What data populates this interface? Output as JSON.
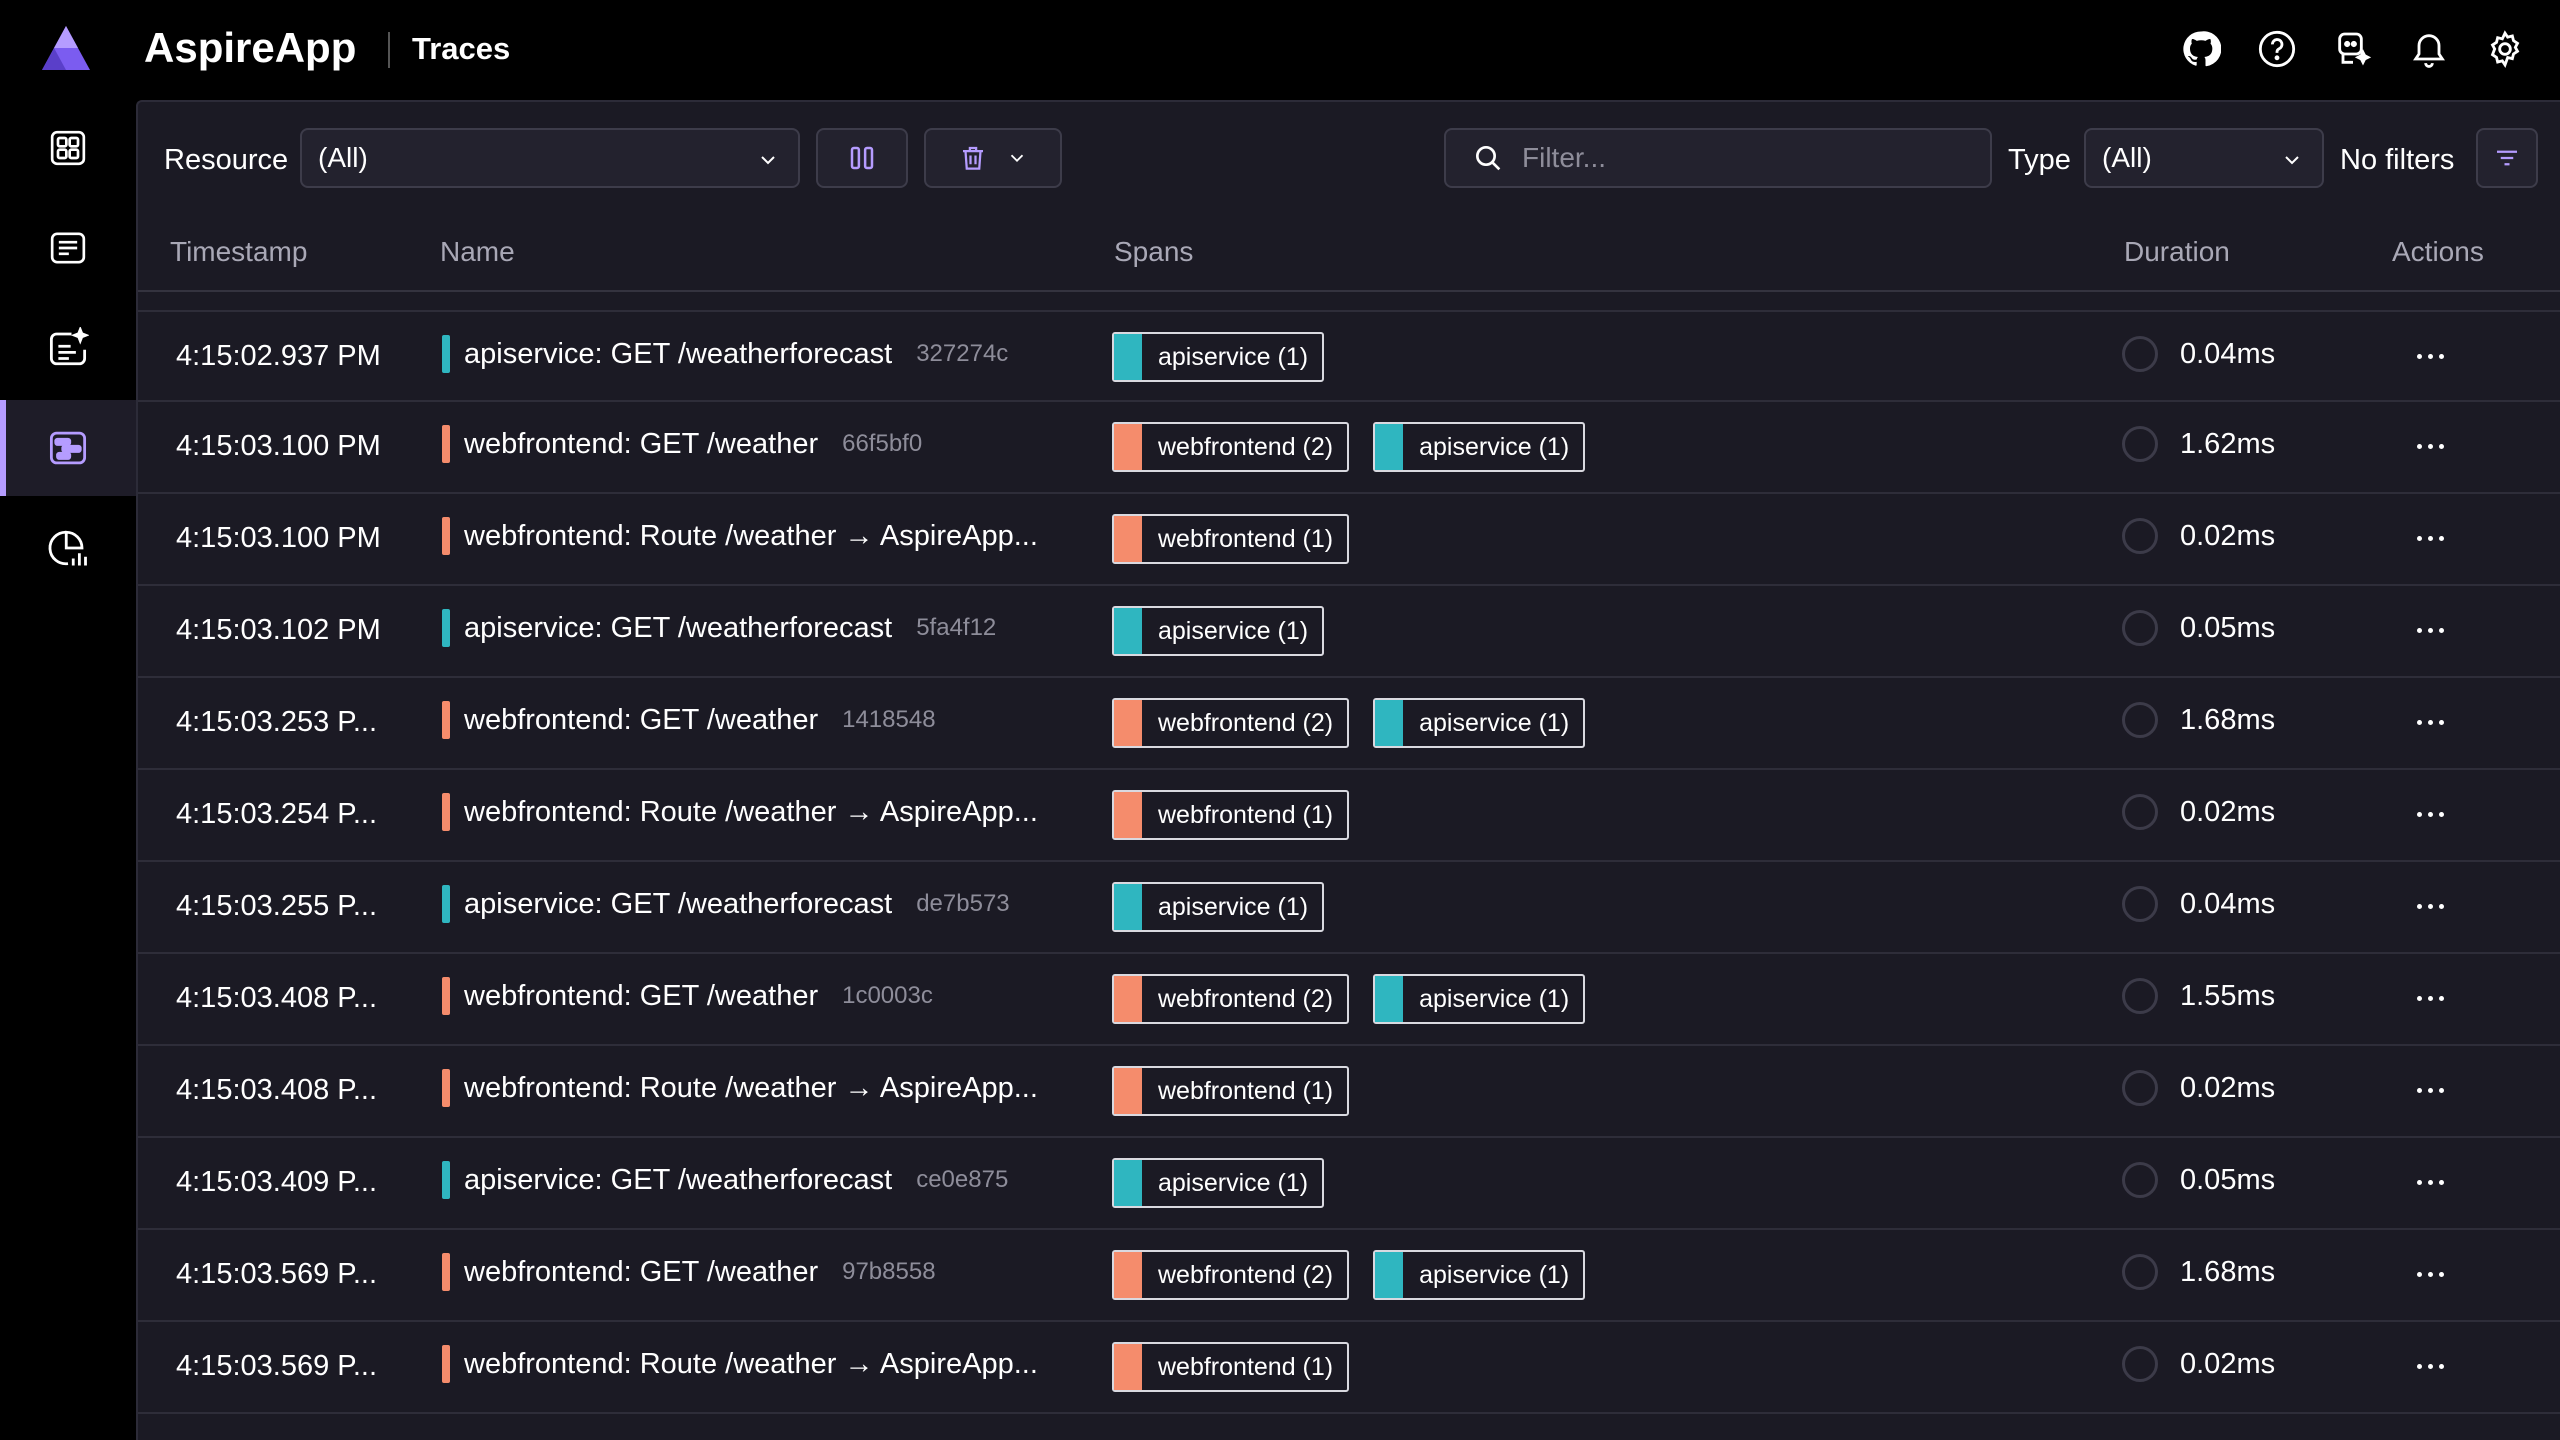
{
  "app": {
    "name": "AspireApp",
    "page": "Traces"
  },
  "colors": {
    "accent": "#b59cff",
    "webfrontend": "#f58c6c",
    "apiservice": "#2fb6c0"
  },
  "top_icons": [
    "github-icon",
    "help-icon",
    "copilot-icon",
    "notifications-icon",
    "settings-icon"
  ],
  "nav": [
    "resources-icon",
    "console-logs-icon",
    "structured-logs-icon",
    "traces-icon",
    "metrics-icon"
  ],
  "toolbar": {
    "resource_label": "Resource",
    "resource_value": "(All)",
    "filter_placeholder": "Filter...",
    "type_label": "Type",
    "type_value": "(All)",
    "no_filters": "No filters"
  },
  "columns": [
    "Timestamp",
    "Name",
    "Spans",
    "Duration",
    "Actions"
  ],
  "rows": [
    {
      "ts": "4:15:02.937 PM",
      "res": "apiservice",
      "name": "apiservice: GET /weatherforecast",
      "id": "327274c",
      "spans": [
        {
          "res": "apiservice",
          "label": "apiservice (1)"
        }
      ],
      "dur": "0.04ms"
    },
    {
      "ts": "4:15:03.100 PM",
      "res": "webfrontend",
      "name": "webfrontend: GET /weather",
      "id": "66f5bf0",
      "spans": [
        {
          "res": "webfrontend",
          "label": "webfrontend (2)"
        },
        {
          "res": "apiservice",
          "label": "apiservice (1)"
        }
      ],
      "dur": "1.62ms"
    },
    {
      "ts": "4:15:03.100 PM",
      "res": "webfrontend",
      "name": "webfrontend: Route /weather → AspireApp...",
      "id": "",
      "spans": [
        {
          "res": "webfrontend",
          "label": "webfrontend (1)"
        }
      ],
      "dur": "0.02ms"
    },
    {
      "ts": "4:15:03.102 PM",
      "res": "apiservice",
      "name": "apiservice: GET /weatherforecast",
      "id": "5fa4f12",
      "spans": [
        {
          "res": "apiservice",
          "label": "apiservice (1)"
        }
      ],
      "dur": "0.05ms"
    },
    {
      "ts": "4:15:03.253 P...",
      "res": "webfrontend",
      "name": "webfrontend: GET /weather",
      "id": "1418548",
      "spans": [
        {
          "res": "webfrontend",
          "label": "webfrontend (2)"
        },
        {
          "res": "apiservice",
          "label": "apiservice (1)"
        }
      ],
      "dur": "1.68ms"
    },
    {
      "ts": "4:15:03.254 P...",
      "res": "webfrontend",
      "name": "webfrontend: Route /weather → AspireApp...",
      "id": "",
      "spans": [
        {
          "res": "webfrontend",
          "label": "webfrontend (1)"
        }
      ],
      "dur": "0.02ms"
    },
    {
      "ts": "4:15:03.255 P...",
      "res": "apiservice",
      "name": "apiservice: GET /weatherforecast",
      "id": "de7b573",
      "spans": [
        {
          "res": "apiservice",
          "label": "apiservice (1)"
        }
      ],
      "dur": "0.04ms"
    },
    {
      "ts": "4:15:03.408 P...",
      "res": "webfrontend",
      "name": "webfrontend: GET /weather",
      "id": "1c0003c",
      "spans": [
        {
          "res": "webfrontend",
          "label": "webfrontend (2)"
        },
        {
          "res": "apiservice",
          "label": "apiservice (1)"
        }
      ],
      "dur": "1.55ms"
    },
    {
      "ts": "4:15:03.408 P...",
      "res": "webfrontend",
      "name": "webfrontend: Route /weather → AspireApp...",
      "id": "",
      "spans": [
        {
          "res": "webfrontend",
          "label": "webfrontend (1)"
        }
      ],
      "dur": "0.02ms"
    },
    {
      "ts": "4:15:03.409 P...",
      "res": "apiservice",
      "name": "apiservice: GET /weatherforecast",
      "id": "ce0e875",
      "spans": [
        {
          "res": "apiservice",
          "label": "apiservice (1)"
        }
      ],
      "dur": "0.05ms"
    },
    {
      "ts": "4:15:03.569 P...",
      "res": "webfrontend",
      "name": "webfrontend: GET /weather",
      "id": "97b8558",
      "spans": [
        {
          "res": "webfrontend",
          "label": "webfrontend (2)"
        },
        {
          "res": "apiservice",
          "label": "apiservice (1)"
        }
      ],
      "dur": "1.68ms"
    },
    {
      "ts": "4:15:03.569 P...",
      "res": "webfrontend",
      "name": "webfrontend: Route /weather → AspireApp...",
      "id": "",
      "spans": [
        {
          "res": "webfrontend",
          "label": "webfrontend (1)"
        }
      ],
      "dur": "0.02ms"
    }
  ]
}
